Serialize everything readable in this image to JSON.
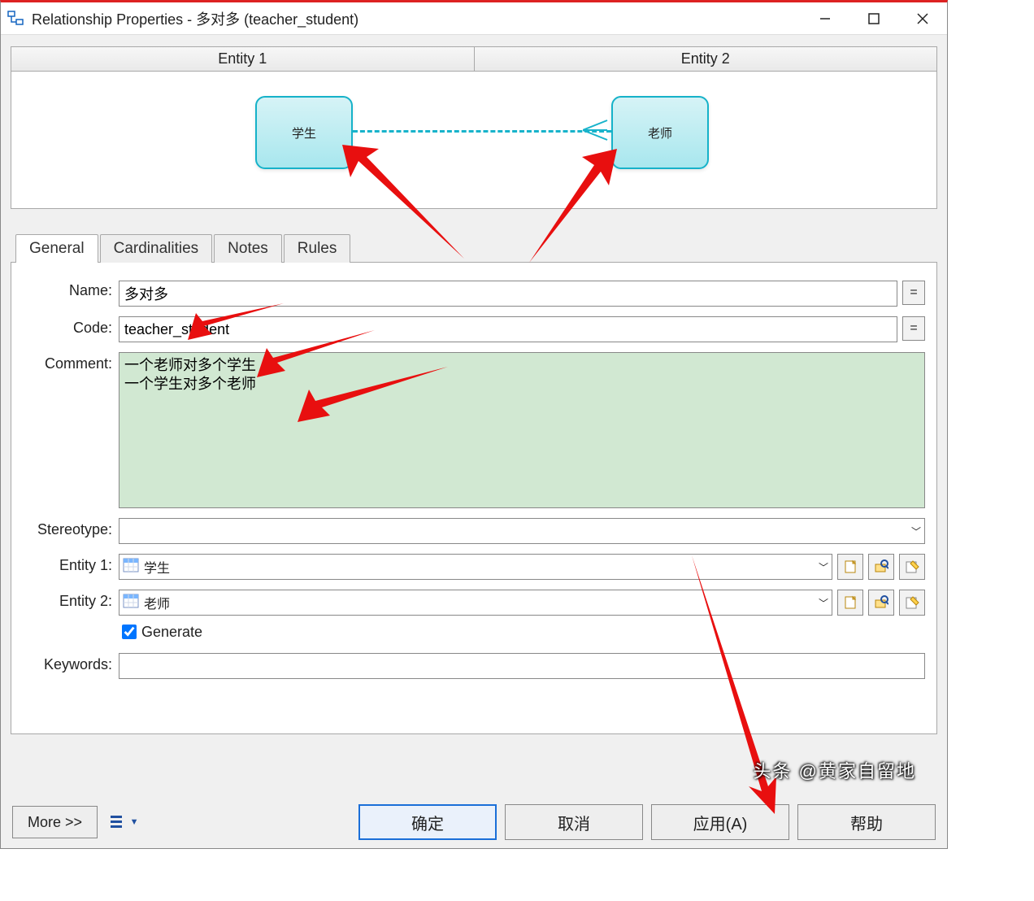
{
  "window": {
    "title": "Relationship Properties - 多对多 (teacher_student)"
  },
  "preview": {
    "col1": "Entity 1",
    "col2": "Entity 2",
    "entity1_label": "学生",
    "entity2_label": "老师"
  },
  "tabs": [
    "General",
    "Cardinalities",
    "Notes",
    "Rules"
  ],
  "active_tab": "General",
  "form": {
    "name_label": "Name:",
    "name_value": "多对多",
    "code_label": "Code:",
    "code_value": "teacher_student",
    "comment_label": "Comment:",
    "comment_value": "一个老师对多个学生\n一个学生对多个老师",
    "stereotype_label": "Stereotype:",
    "stereotype_value": "",
    "entity1_label": "Entity 1:",
    "entity1_value": "学生",
    "entity2_label": "Entity 2:",
    "entity2_value": "老师",
    "generate_label": "Generate",
    "generate_checked": true,
    "keywords_label": "Keywords:",
    "keywords_value": "",
    "eq_label": "="
  },
  "buttons": {
    "more": "More >>",
    "ok": "确定",
    "cancel": "取消",
    "apply": "应用(A)",
    "help": "帮助"
  },
  "watermark": "头条 @黄家自留地"
}
